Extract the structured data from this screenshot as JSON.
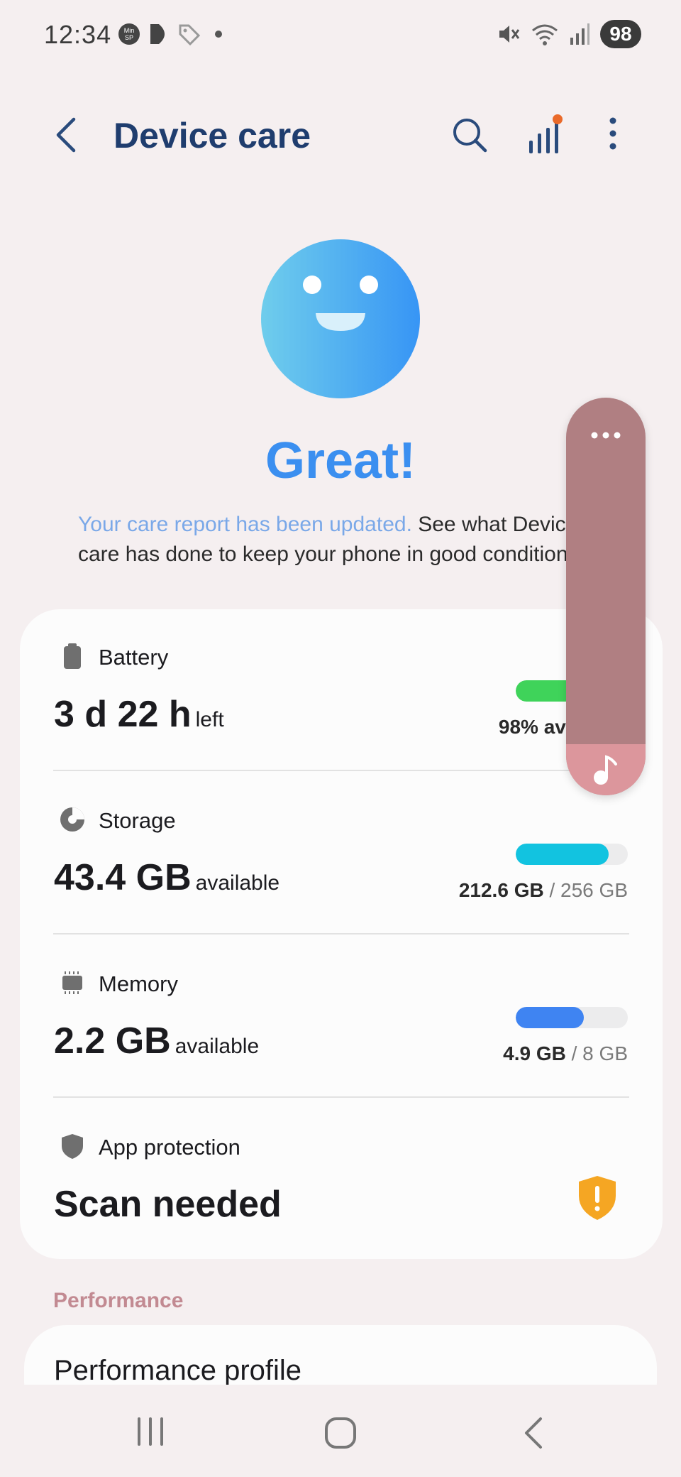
{
  "status_bar": {
    "time": "12:34",
    "battery_level": "98",
    "icons": [
      "minsp-icon",
      "play-icon",
      "tag-icon",
      "dot-icon",
      "mute-icon",
      "wifi-icon",
      "signal-icon"
    ]
  },
  "header": {
    "title": "Device care",
    "icons": [
      "back-icon",
      "search-icon",
      "stats-icon",
      "more-icon"
    ],
    "badge_color": "#ea6a2a"
  },
  "hero": {
    "status": "Great!",
    "desc_link": "Your care report has been updated.",
    "desc_line1_rest": " See what Device",
    "desc_line2": "care has done to keep your phone in good condition."
  },
  "summary": {
    "battery": {
      "label": "Battery",
      "value": "3 d 22 h",
      "unit": "left",
      "caption": "98% available",
      "level_percent": 98,
      "color": "#3fd35a"
    },
    "storage": {
      "label": "Storage",
      "value": "43.4 GB",
      "unit": "available",
      "used": "212.6 GB",
      "total": " / 256 GB",
      "used_fraction": 0.83,
      "color": "#12c3e0"
    },
    "memory": {
      "label": "Memory",
      "value": "2.2 GB",
      "unit": "available",
      "used": "4.9 GB",
      "total": " / 8 GB",
      "used_fraction": 0.61,
      "color": "#3f84f2"
    },
    "app_protection": {
      "label": "App protection",
      "value": "Scan needed",
      "warning_color": "#f5a623"
    }
  },
  "performance": {
    "section": "Performance",
    "item": "Performance profile"
  },
  "nav": {
    "icons": [
      "recents-icon",
      "home-icon",
      "back-icon"
    ]
  }
}
